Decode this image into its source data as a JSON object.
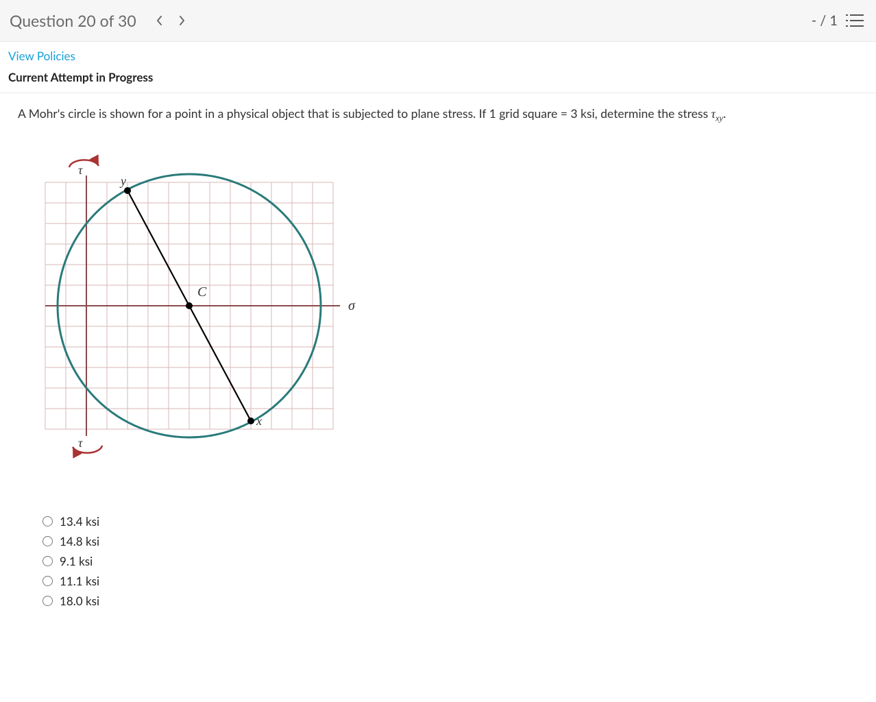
{
  "header": {
    "title": "Question 20 of 30",
    "score": "- / 1"
  },
  "links": {
    "view_policies": "View Policies",
    "attempt": "Current Attempt in Progress"
  },
  "question": {
    "prompt_prefix": "A Mohr's circle is shown for a point in a physical object that is subjected to plane stress. If 1 grid square = 3 ksi, determine the stress ",
    "symbol_html": "τ<sub>xy</sub>",
    "prompt_suffix": "."
  },
  "figure": {
    "axis_sigma": "σ",
    "axis_tau": "τ",
    "label_c": "C",
    "label_x": "x",
    "label_y": "y",
    "grid_square_ksi": 3,
    "grid_range_x": [
      -2,
      12
    ],
    "grid_range_y": [
      -7,
      7
    ],
    "center_grid": [
      5,
      0
    ],
    "radius_grid": 6.4,
    "point_y_grid": [
      2,
      5.6
    ],
    "point_x_grid": [
      8,
      -5.6
    ]
  },
  "options": [
    {
      "label": "13.4 ksi"
    },
    {
      "label": "14.8 ksi"
    },
    {
      "label": "9.1 ksi"
    },
    {
      "label": "11.1 ksi"
    },
    {
      "label": "18.0 ksi"
    }
  ]
}
